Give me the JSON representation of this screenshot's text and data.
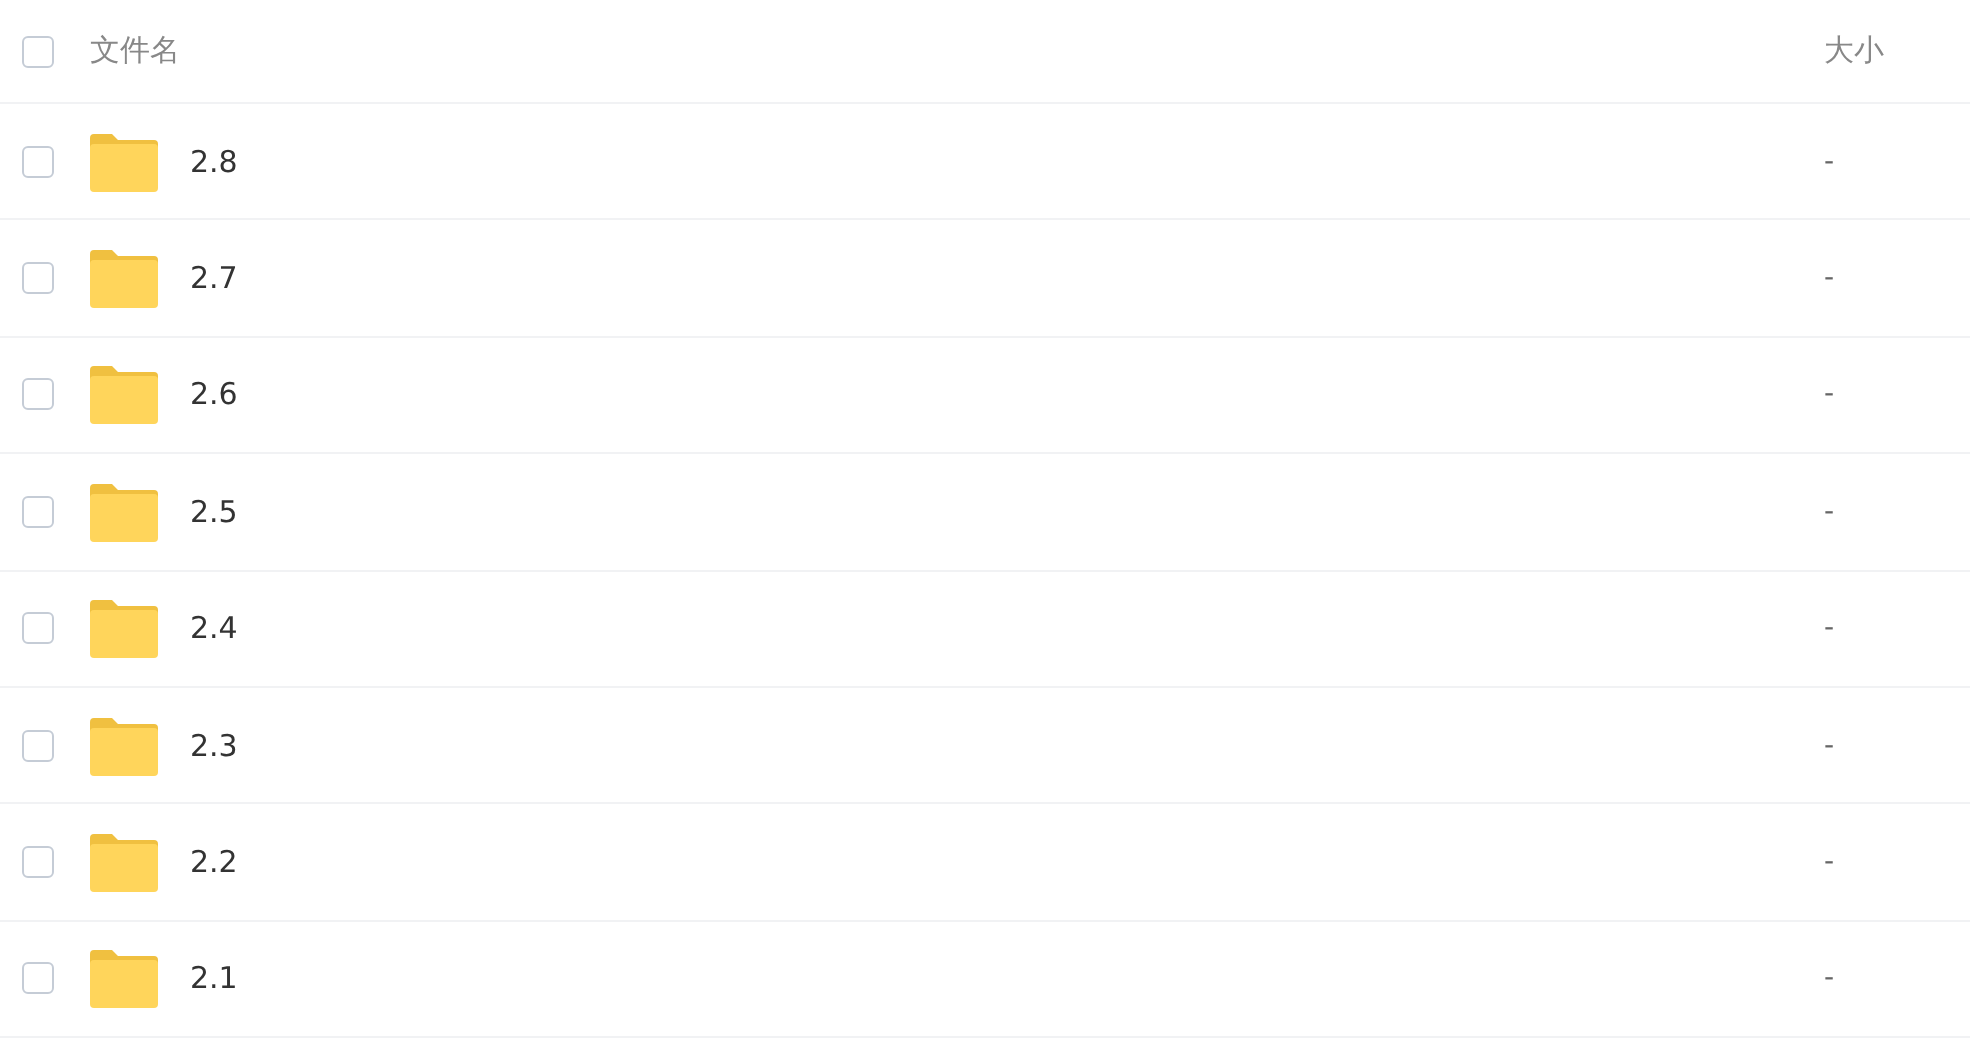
{
  "header": {
    "checked": false,
    "name_column": "文件名",
    "size_column": "大小"
  },
  "rows": [
    {
      "name": "2.8",
      "size": "-",
      "checked": false
    },
    {
      "name": "2.7",
      "size": "-",
      "checked": false
    },
    {
      "name": "2.6",
      "size": "-",
      "checked": false
    },
    {
      "name": "2.5",
      "size": "-",
      "checked": false
    },
    {
      "name": "2.4",
      "size": "-",
      "checked": false
    },
    {
      "name": "2.3",
      "size": "-",
      "checked": false
    },
    {
      "name": "2.2",
      "size": "-",
      "checked": false
    },
    {
      "name": "2.1",
      "size": "-",
      "checked": false
    }
  ]
}
